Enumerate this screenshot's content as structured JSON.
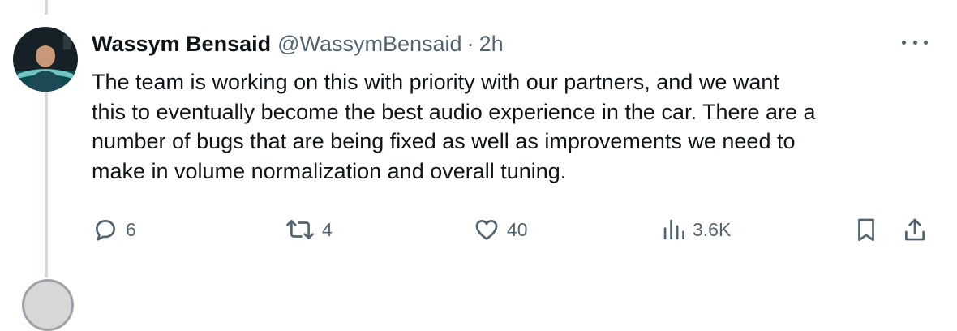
{
  "tweet": {
    "author_name": "Wassym Bensaid",
    "handle": "@WassymBensaid",
    "separator": "·",
    "time": "2h",
    "text": "The team is working on this with priority with our partners, and we want\nthis to eventually become the best audio experience in the car. There are a\nnumber of bugs that are being fixed as well as improvements we need to\nmake in volume normalization and overall tuning."
  },
  "actions": {
    "replies": "6",
    "retweets": "4",
    "likes": "40",
    "views": "3.6K"
  },
  "icons": {
    "reply": "reply-icon",
    "retweet": "retweet-icon",
    "like": "heart-icon",
    "views": "views-icon",
    "bookmark": "bookmark-icon",
    "share": "share-icon",
    "more": "more-icon"
  },
  "colors": {
    "text": "#0f1419",
    "secondary": "#536471",
    "thread_line": "#cfd9de"
  }
}
